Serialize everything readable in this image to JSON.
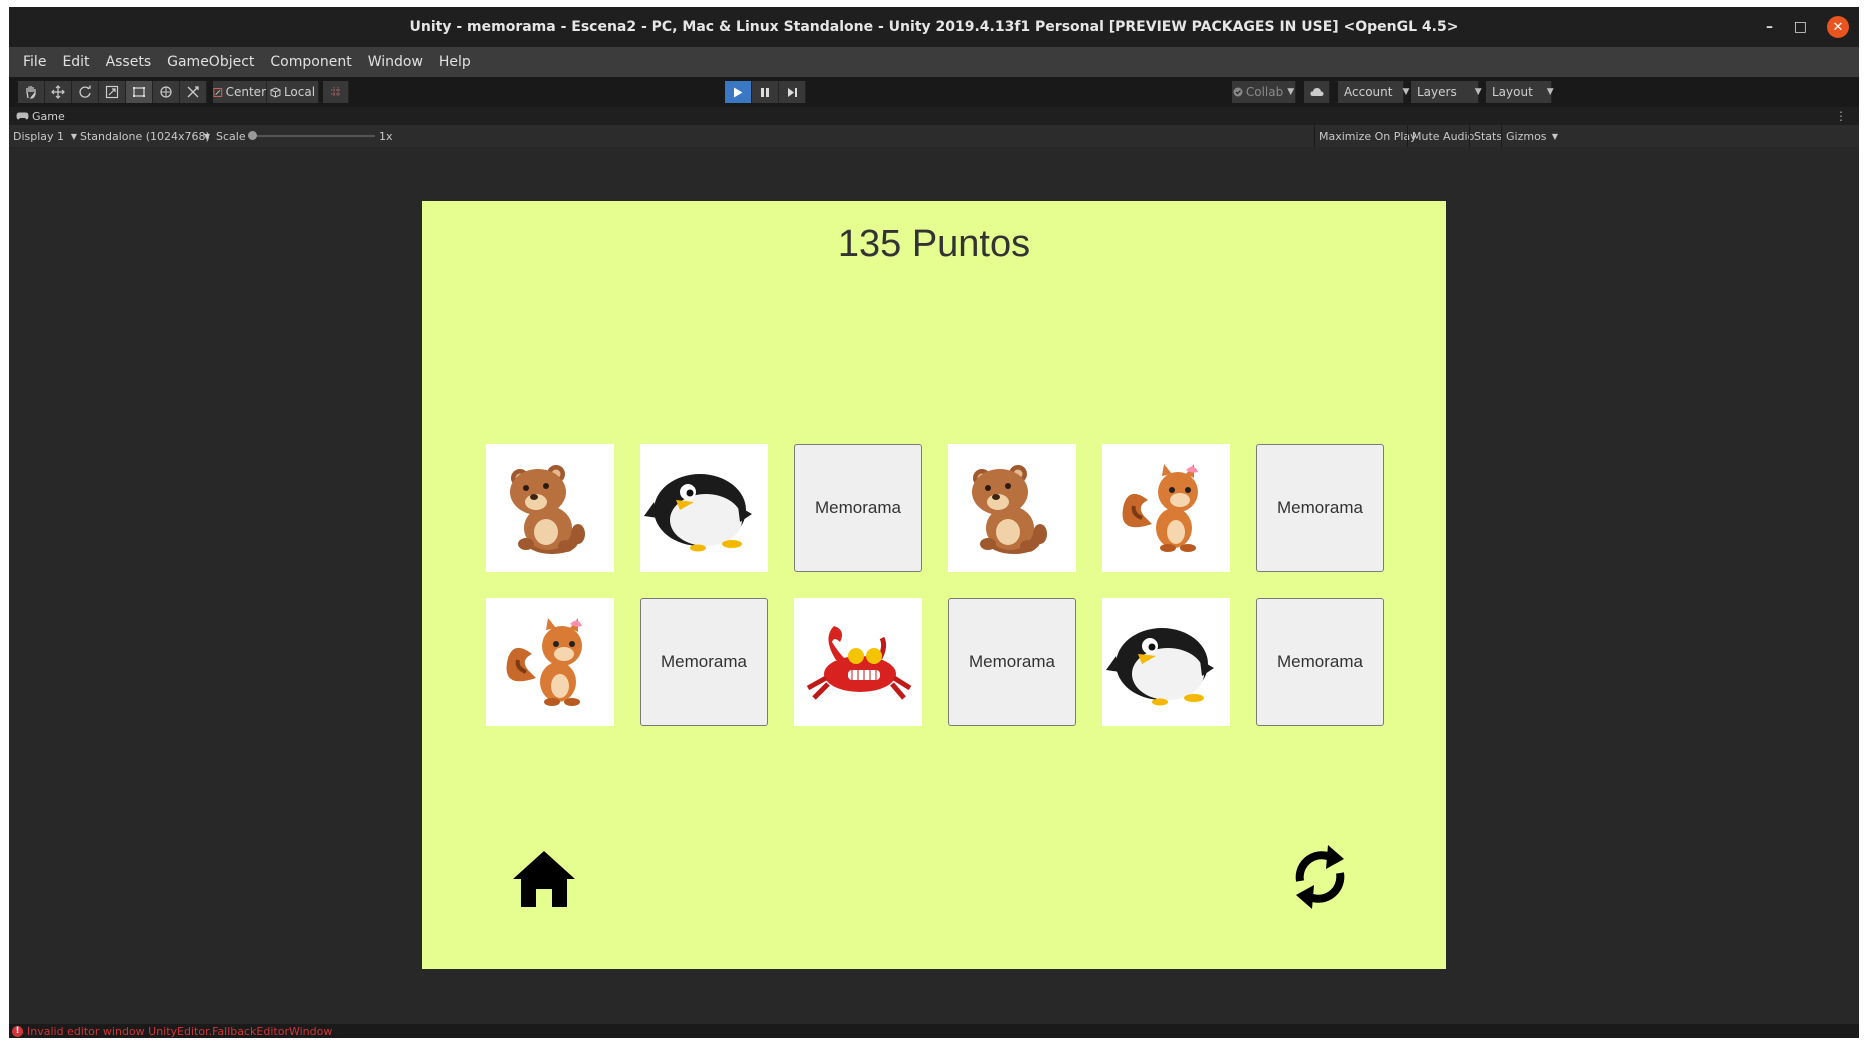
{
  "window": {
    "title": "Unity - memorama - Escena2 - PC, Mac & Linux Standalone - Unity 2019.4.13f1 Personal [PREVIEW PACKAGES IN USE] <OpenGL 4.5>",
    "controls": {
      "minimize": "–",
      "maximize": "□",
      "close": "✕"
    }
  },
  "menu": [
    "File",
    "Edit",
    "Assets",
    "GameObject",
    "Component",
    "Window",
    "Help"
  ],
  "toolbar": {
    "tools": [
      "hand-tool",
      "move-tool",
      "rotate-tool",
      "scale-tool",
      "rect-tool",
      "transform-tool",
      "custom-tool"
    ],
    "pivot_mode": "Center",
    "pivot_rotation": "Local",
    "collab": "Collab",
    "account": "Account",
    "layers": "Layers",
    "layout": "Layout"
  },
  "game_tab": {
    "label": "Game"
  },
  "game_bar": {
    "display": "Display 1",
    "resolution": "Standalone (1024x768)",
    "scale_label": "Scale",
    "scale_value": "1x",
    "maximize_on_play": "Maximize On Play",
    "mute_audio": "Mute Audio",
    "stats": "Stats",
    "gizmos": "Gizmos"
  },
  "game": {
    "score": "135 Puntos",
    "cards_row1": [
      {
        "state": "face",
        "animal": "bear"
      },
      {
        "state": "face",
        "animal": "penguin"
      },
      {
        "state": "back",
        "label": "Memorama"
      },
      {
        "state": "face",
        "animal": "bear"
      },
      {
        "state": "face",
        "animal": "squirrel"
      },
      {
        "state": "back",
        "label": "Memorama"
      }
    ],
    "cards_row2": [
      {
        "state": "face",
        "animal": "squirrel"
      },
      {
        "state": "back",
        "label": "Memorama"
      },
      {
        "state": "face",
        "animal": "crab"
      },
      {
        "state": "back",
        "label": "Memorama"
      },
      {
        "state": "face",
        "animal": "penguin"
      },
      {
        "state": "back",
        "label": "Memorama"
      }
    ],
    "home_icon": "home-icon",
    "refresh_icon": "refresh-icon"
  },
  "status": {
    "message": "Invalid editor window UnityEditor.FallbackEditorWindow"
  },
  "colors": {
    "canvas_bg": "#e6fd90",
    "play_active": "#3b78c4",
    "error": "#d4333a",
    "close_btn": "#e95420"
  }
}
